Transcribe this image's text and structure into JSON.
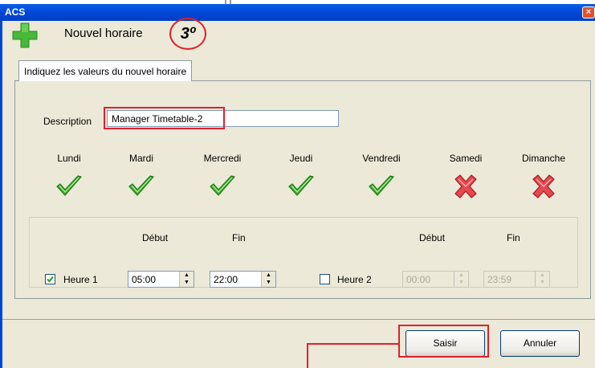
{
  "window": {
    "title": "ACS",
    "close_glyph": "×"
  },
  "header": {
    "title": "Nouvel horaire",
    "step": "3º",
    "icon": "plus-icon"
  },
  "tab": {
    "label": "Indiquez les valeurs du nouvel horaire"
  },
  "description": {
    "label": "Description",
    "value": "Manager Timetable-2"
  },
  "days": [
    {
      "label": "Lundi",
      "enabled": true,
      "icon": "check-icon"
    },
    {
      "label": "Mardi",
      "enabled": true,
      "icon": "check-icon"
    },
    {
      "label": "Mercredi",
      "enabled": true,
      "icon": "check-icon"
    },
    {
      "label": "Jeudi",
      "enabled": true,
      "icon": "check-icon"
    },
    {
      "label": "Vendredi",
      "enabled": true,
      "icon": "check-icon"
    },
    {
      "label": "Samedi",
      "enabled": false,
      "icon": "cross-icon"
    },
    {
      "label": "Dimanche",
      "enabled": false,
      "icon": "cross-icon"
    }
  ],
  "hour1": {
    "label": "Heure 1",
    "checked": true,
    "start_header": "Début",
    "end_header": "Fin",
    "start": "05:00",
    "end": "22:00"
  },
  "hour2": {
    "label": "Heure 2",
    "checked": false,
    "start_header": "Début",
    "end_header": "Fin",
    "start": "00:00",
    "end": "23:59"
  },
  "buttons": {
    "submit": "Saisir",
    "cancel": "Annuler"
  },
  "colors": {
    "titlebar": "#0046d5",
    "dialog_bg": "#ece9d8",
    "highlight": "#e0202e",
    "check_green": "#3fae2a",
    "cross_red": "#e5484d"
  }
}
